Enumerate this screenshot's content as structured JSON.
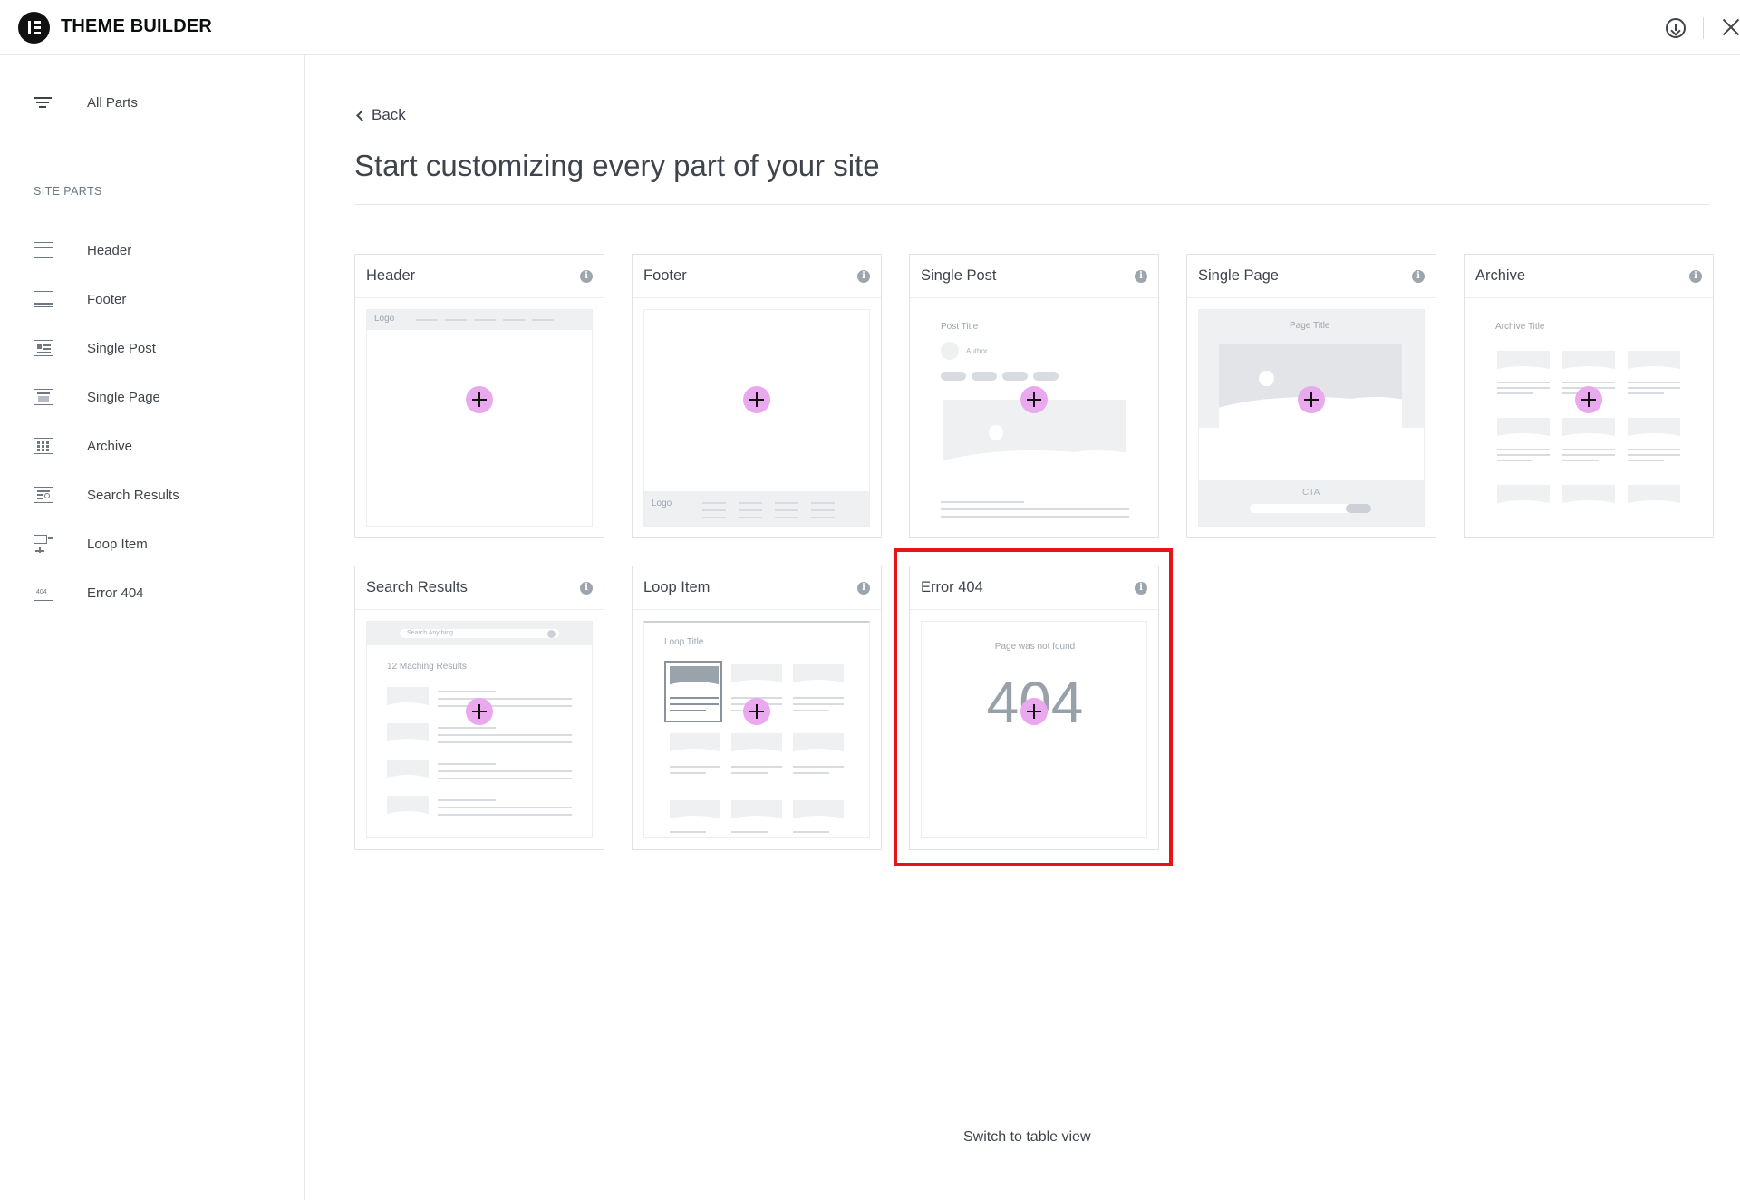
{
  "app": {
    "title": "THEME BUILDER"
  },
  "sidebar": {
    "all_parts": "All Parts",
    "section_label": "SITE PARTS",
    "items": [
      {
        "label": "Header",
        "icon": "header-layout-icon"
      },
      {
        "label": "Footer",
        "icon": "footer-layout-icon"
      },
      {
        "label": "Single Post",
        "icon": "single-post-icon"
      },
      {
        "label": "Single Page",
        "icon": "single-page-icon"
      },
      {
        "label": "Archive",
        "icon": "archive-grid-icon"
      },
      {
        "label": "Search Results",
        "icon": "search-results-icon"
      },
      {
        "label": "Loop Item",
        "icon": "loop-item-icon"
      },
      {
        "label": "Error 404",
        "icon": "error-404-icon",
        "icon_text": "404"
      }
    ]
  },
  "main": {
    "back_label": "Back",
    "title": "Start customizing every part of your site",
    "cards": [
      {
        "title": "Header",
        "preview": {
          "logo": "Logo"
        }
      },
      {
        "title": "Footer",
        "preview": {
          "logo": "Logo"
        }
      },
      {
        "title": "Single Post",
        "preview": {
          "post_title": "Post Title",
          "author": "Author"
        }
      },
      {
        "title": "Single Page",
        "preview": {
          "page_title": "Page Title",
          "cta": "CTA"
        }
      },
      {
        "title": "Archive",
        "preview": {
          "archive_title": "Archive Title"
        }
      },
      {
        "title": "Search Results",
        "preview": {
          "search_placeholder": "Search Anything",
          "results": "12 Maching Results"
        }
      },
      {
        "title": "Loop Item",
        "preview": {
          "loop_title": "Loop Title"
        }
      },
      {
        "title": "Error 404",
        "preview": {
          "not_found": "Page was not found",
          "code": "404"
        },
        "highlighted": true
      }
    ],
    "info_glyph": "i",
    "switch_view": "Switch to table view"
  },
  "colors": {
    "text": "#3f444b",
    "add_button": "#eaa8ee",
    "highlight_border": "#e5141a"
  }
}
